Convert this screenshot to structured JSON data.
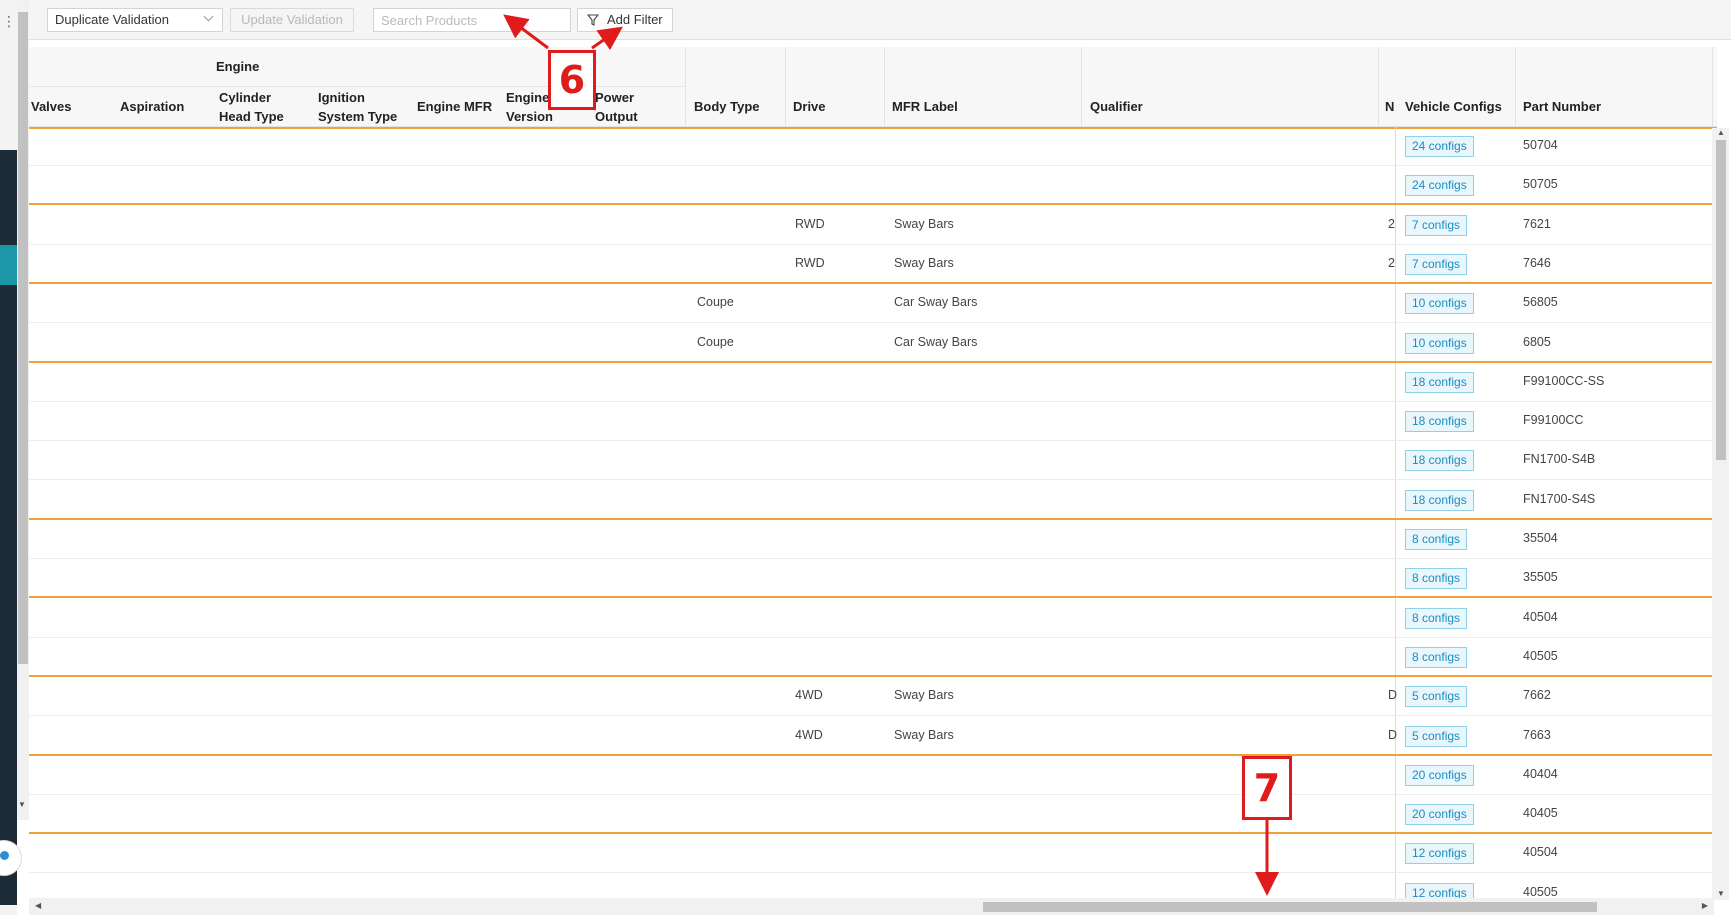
{
  "toolbar": {
    "view_select": "Duplicate Validation",
    "update_button": "Update Validation",
    "search_placeholder": "Search Products",
    "filter_button": "Add Filter"
  },
  "grid": {
    "group_header": "Engine",
    "columns": {
      "valves": "Valves",
      "aspiration": "Aspiration",
      "cylinder_head_type": [
        "Cylinder",
        "Head Type"
      ],
      "ignition_system_type": [
        "Ignition",
        "System Type"
      ],
      "engine_mfr": "Engine MFR",
      "engine_version": [
        "Engine",
        "Version"
      ],
      "power_output": [
        "Power",
        "Output"
      ],
      "body_type": "Body Type",
      "drive": "Drive",
      "mfr_label": "MFR Label",
      "qualifier": "Qualifier",
      "truncated": "N",
      "vehicle_configs": "Vehicle Configs",
      "part_number": "Part Number"
    },
    "rows": [
      {
        "body": "",
        "drive": "",
        "mfr": "",
        "trunc": "",
        "configs": "24 configs",
        "part": "50704",
        "group_end": false
      },
      {
        "body": "",
        "drive": "",
        "mfr": "",
        "trunc": "",
        "configs": "24 configs",
        "part": "50705",
        "group_end": true
      },
      {
        "body": "",
        "drive": "RWD",
        "mfr": "Sway Bars",
        "trunc": "2",
        "configs": "7 configs",
        "part": "7621",
        "group_end": false
      },
      {
        "body": "",
        "drive": "RWD",
        "mfr": "Sway Bars",
        "trunc": "2",
        "configs": "7 configs",
        "part": "7646",
        "group_end": true
      },
      {
        "body": "Coupe",
        "drive": "",
        "mfr": "Car Sway Bars",
        "trunc": "",
        "configs": "10 configs",
        "part": "56805",
        "group_end": false
      },
      {
        "body": "Coupe",
        "drive": "",
        "mfr": "Car Sway Bars",
        "trunc": "",
        "configs": "10 configs",
        "part": "6805",
        "group_end": true
      },
      {
        "body": "",
        "drive": "",
        "mfr": "",
        "trunc": "",
        "configs": "18 configs",
        "part": "F99100CC-SS",
        "group_end": false
      },
      {
        "body": "",
        "drive": "",
        "mfr": "",
        "trunc": "",
        "configs": "18 configs",
        "part": "F99100CC",
        "group_end": false
      },
      {
        "body": "",
        "drive": "",
        "mfr": "",
        "trunc": "",
        "configs": "18 configs",
        "part": "FN1700-S4B",
        "group_end": false
      },
      {
        "body": "",
        "drive": "",
        "mfr": "",
        "trunc": "",
        "configs": "18 configs",
        "part": "FN1700-S4S",
        "group_end": true
      },
      {
        "body": "",
        "drive": "",
        "mfr": "",
        "trunc": "",
        "configs": "8 configs",
        "part": "35504",
        "group_end": false
      },
      {
        "body": "",
        "drive": "",
        "mfr": "",
        "trunc": "",
        "configs": "8 configs",
        "part": "35505",
        "group_end": true
      },
      {
        "body": "",
        "drive": "",
        "mfr": "",
        "trunc": "",
        "configs": "8 configs",
        "part": "40504",
        "group_end": false
      },
      {
        "body": "",
        "drive": "",
        "mfr": "",
        "trunc": "",
        "configs": "8 configs",
        "part": "40505",
        "group_end": true
      },
      {
        "body": "",
        "drive": "4WD",
        "mfr": "Sway Bars",
        "trunc": "D",
        "configs": "5 configs",
        "part": "7662",
        "group_end": false
      },
      {
        "body": "",
        "drive": "4WD",
        "mfr": "Sway Bars",
        "trunc": "D",
        "configs": "5 configs",
        "part": "7663",
        "group_end": true
      },
      {
        "body": "",
        "drive": "",
        "mfr": "",
        "trunc": "",
        "configs": "20 configs",
        "part": "40404",
        "group_end": false
      },
      {
        "body": "",
        "drive": "",
        "mfr": "",
        "trunc": "",
        "configs": "20 configs",
        "part": "40405",
        "group_end": true
      },
      {
        "body": "",
        "drive": "",
        "mfr": "",
        "trunc": "",
        "configs": "12 configs",
        "part": "40504",
        "group_end": false
      },
      {
        "body": "",
        "drive": "",
        "mfr": "",
        "trunc": "",
        "configs": "12 configs",
        "part": "40505",
        "group_end": false
      }
    ]
  },
  "annotations": {
    "label_6": "6",
    "label_7": "7"
  },
  "colors": {
    "group_border": "#f0a239",
    "badge_text": "#1a8dc2",
    "annotation": "#e01b1b"
  }
}
